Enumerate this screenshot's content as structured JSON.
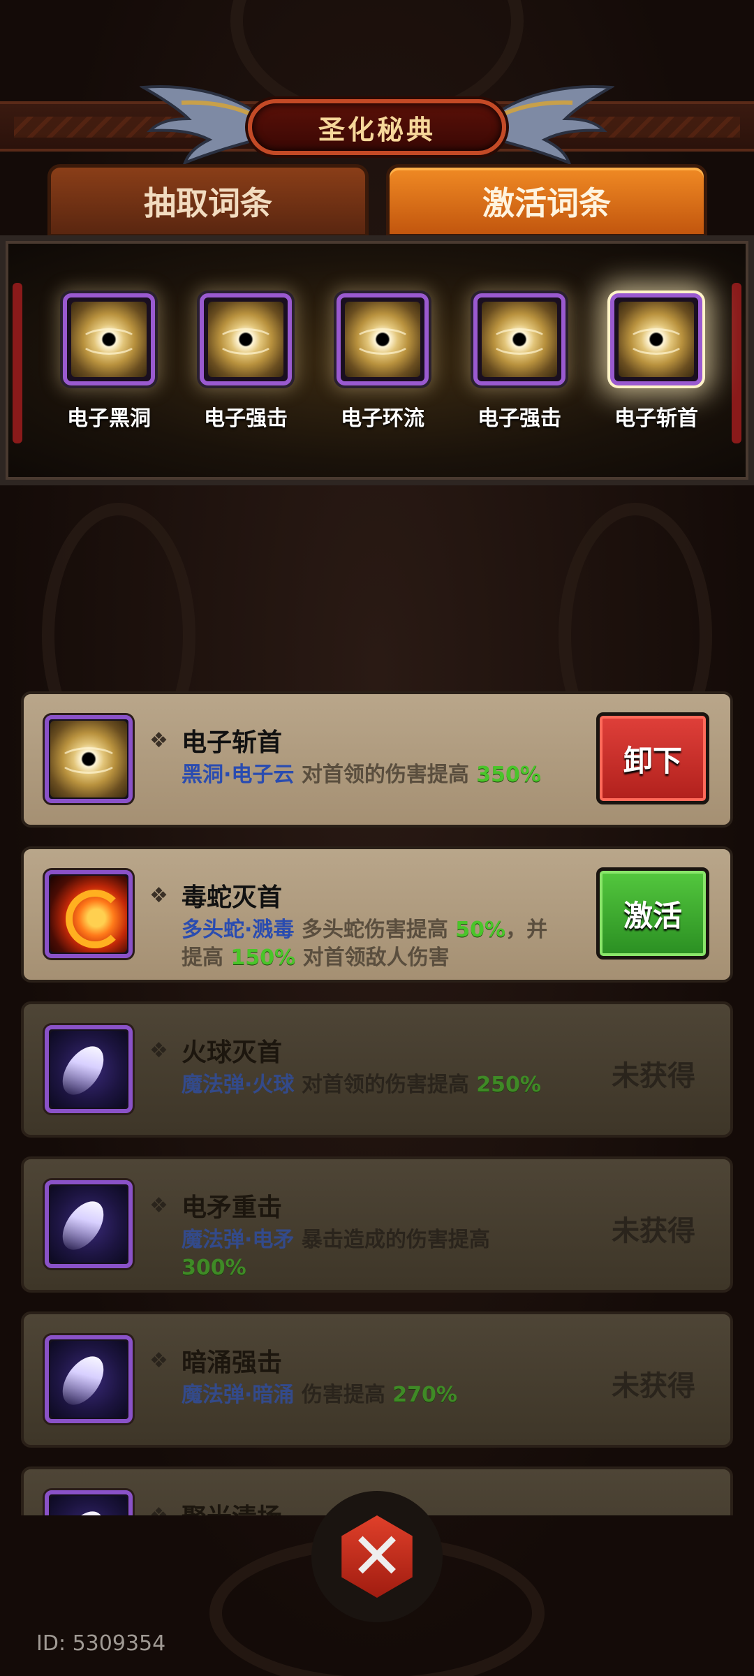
{
  "header": {
    "title": "圣化秘典"
  },
  "tabs": [
    {
      "label": "抽取词条",
      "active": false
    },
    {
      "label": "激活词条",
      "active": true
    }
  ],
  "equipped": [
    {
      "label": "电子黑洞",
      "icon": "black-hole-icon"
    },
    {
      "label": "电子强击",
      "icon": "black-hole-icon"
    },
    {
      "label": "电子环流",
      "icon": "black-hole-icon"
    },
    {
      "label": "电子强击",
      "icon": "black-hole-icon"
    },
    {
      "label": "电子斩首",
      "icon": "black-hole-icon",
      "selected": true
    }
  ],
  "list": [
    {
      "name": "电子斩首",
      "tag": "黑洞·电子云",
      "text1": " 对首领的伤害提高 ",
      "num1": "350%",
      "action": "卸下",
      "icon": "black-hole-icon"
    },
    {
      "name": "毒蛇灭首",
      "tag": "多头蛇·溅毒",
      "text1": " 多头蛇伤害提高 ",
      "num1": "50%",
      "text2": "，并提高 ",
      "num2": "150%",
      "text3": " 对首领敌人伤害",
      "action": "激活",
      "icon": "fire-dragon-icon"
    },
    {
      "name": "火球灭首",
      "tag": "魔法弹·火球",
      "text1": " 对首领的伤害提高 ",
      "num1": "250%",
      "status": "未获得",
      "icon": "magic-bolt-icon"
    },
    {
      "name": "电矛重击",
      "tag": "魔法弹·电矛",
      "text1": " 暴击造成的伤害提高 ",
      "num1": "300%",
      "status": "未获得",
      "icon": "magic-bolt-icon"
    },
    {
      "name": "暗涌强击",
      "tag": "魔法弹·暗涌",
      "text1": " 伤害提高 ",
      "num1": "270%",
      "status": "未获得",
      "icon": "magic-bolt-icon"
    },
    {
      "name": "聚光清场",
      "icon": "magic-bolt-icon"
    }
  ],
  "footer": {
    "user_id": "ID: 5309354",
    "close_icon": "close-x-icon"
  },
  "colors": {
    "accent": "#f08a24",
    "unload": "#c42a24",
    "activate": "#3aa82c",
    "highlight": "#4ac52a",
    "tag": "#2a4cb0"
  }
}
